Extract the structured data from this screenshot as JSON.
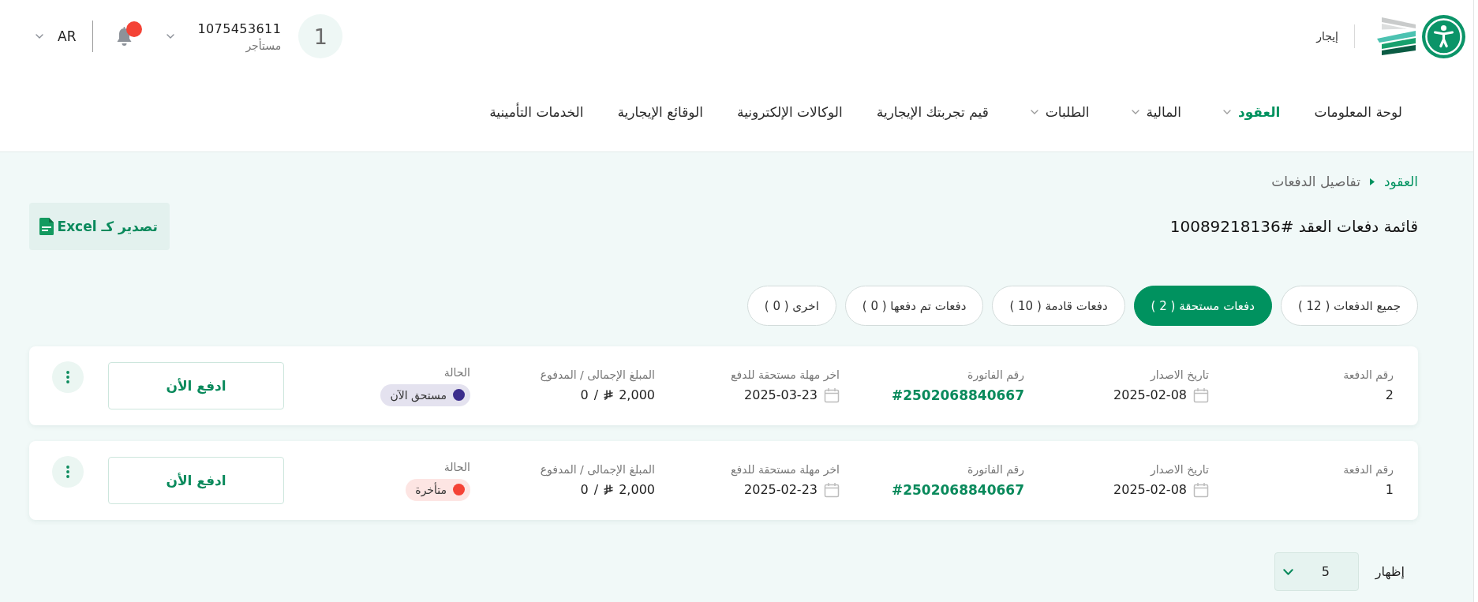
{
  "header": {
    "brand_name": "إيجار",
    "user": {
      "initial": "1",
      "id": "1075453611",
      "role": "مستأجر"
    },
    "notifications": {
      "unread": true
    },
    "language": "AR"
  },
  "nav": [
    {
      "label": "لوحة المعلومات",
      "dropdown": false,
      "selected": false
    },
    {
      "label": "العقود",
      "dropdown": true,
      "selected": true
    },
    {
      "label": "المالية",
      "dropdown": true,
      "selected": false
    },
    {
      "label": "الطلبات",
      "dropdown": true,
      "selected": false
    },
    {
      "label": "قيم تجربتك الإيجارية",
      "dropdown": false,
      "selected": false
    },
    {
      "label": "الوكالات الإلكترونية",
      "dropdown": false,
      "selected": false
    },
    {
      "label": "الوقائع الإيجارية",
      "dropdown": false,
      "selected": false
    },
    {
      "label": "الخدمات التأمينية",
      "dropdown": false,
      "selected": false
    }
  ],
  "breadcrumb": [
    {
      "label": "العقود",
      "kind": "link"
    },
    {
      "label": "تفاصيل الدفعات",
      "kind": "current"
    }
  ],
  "page_title": "قائمة دفعات العقد #10089218136",
  "export_button": {
    "label": "تصدير كـ Excel"
  },
  "tabs": [
    {
      "label": "جميع الدفعات ( 12 )",
      "selected": false
    },
    {
      "label": "دفعات مستحقة ( 2 )",
      "selected": true
    },
    {
      "label": "دفعات قادمة ( 10 )",
      "selected": false
    },
    {
      "label": "دفعات تم دفعها ( 0 )",
      "selected": false
    },
    {
      "label": "اخرى ( 0 )",
      "selected": false
    }
  ],
  "payments": [
    {
      "fields": [
        {
          "kind": "number",
          "label": "رقم الدفعة",
          "value": "2"
        },
        {
          "kind": "date",
          "label": "تاريخ الاصدار",
          "value": "2025-02-08"
        },
        {
          "kind": "invoice",
          "label": "رقم الفاتورة",
          "value": "#2502068840667"
        },
        {
          "kind": "date",
          "label": "اخر مهلة مستحقة للدفع",
          "value": "2025-03-23"
        },
        {
          "kind": "amount",
          "label": "المبلغ الإجمالى / المدفوع",
          "total": "2,000",
          "separator": "/",
          "paid": "0"
        },
        {
          "kind": "status",
          "label": "الحالة",
          "value": "مستحق الآن",
          "color": "#3b2d8c"
        }
      ],
      "pay_button": "ادفع الأن"
    },
    {
      "fields": [
        {
          "kind": "number",
          "label": "رقم الدفعة",
          "value": "1"
        },
        {
          "kind": "date",
          "label": "تاريخ الاصدار",
          "value": "2025-02-08"
        },
        {
          "kind": "invoice",
          "label": "رقم الفاتورة",
          "value": "#2502068840667"
        },
        {
          "kind": "date",
          "label": "اخر مهلة مستحقة للدفع",
          "value": "2025-02-23"
        },
        {
          "kind": "amount",
          "label": "المبلغ الإجمالى / المدفوع",
          "total": "2,000",
          "separator": "/",
          "paid": "0"
        },
        {
          "kind": "status",
          "label": "الحالة",
          "value": "متأخرة",
          "color": "#f44336"
        }
      ],
      "pay_button": "ادفع الأن"
    }
  ],
  "page_size": {
    "label": "إظهار",
    "value": "5"
  }
}
